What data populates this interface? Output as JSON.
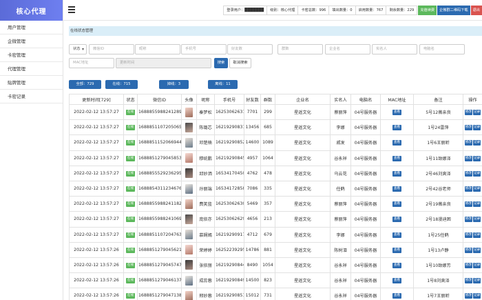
{
  "app": {
    "logo": "核心代理"
  },
  "sidebar": {
    "items": [
      {
        "label": "用户管理"
      },
      {
        "label": "企微管理"
      },
      {
        "label": "卡密管理"
      },
      {
        "label": "代理管理"
      },
      {
        "label": "贴牌管理"
      },
      {
        "label": "卡密记录"
      }
    ]
  },
  "header": {
    "stats": [
      {
        "label": "登录用户：",
        "value": "███████"
      },
      {
        "label": "级别：",
        "value": "核心代理"
      },
      {
        "label": "卡密总数：",
        "value": "996"
      },
      {
        "label": "填出数量：",
        "value": "0"
      },
      {
        "label": "启用数量：",
        "value": "767"
      },
      {
        "label": "剩余数量：",
        "value": "229"
      }
    ],
    "buttons": [
      {
        "label": "充值续费",
        "color": "#5cb85c"
      },
      {
        "label": "企微群二维码下载",
        "color": "#2b6ab0"
      },
      {
        "label": "退出",
        "color": "#d9534f"
      }
    ]
  },
  "panel": {
    "title": "在线状态管理"
  },
  "filters": {
    "status_select": "状态",
    "placeholders": [
      "微信ID",
      "昵称",
      "手机号",
      "好友数",
      "群数",
      "企业名",
      "实名人",
      "电脑名",
      "MAC地址",
      "更新时间"
    ],
    "search_button": "搜索",
    "cancel_button": "取消搜索"
  },
  "tabs": [
    {
      "label": "全部：729"
    },
    {
      "label": "在线：715"
    },
    {
      "label": "掉线：3"
    },
    {
      "label": "离线：11"
    }
  ],
  "table": {
    "columns": [
      "更新时间[729]",
      "状态",
      "微信ID",
      "头像",
      "昵称",
      "手机号",
      "好友数",
      "群数",
      "企业名",
      "实名人",
      "电脑名",
      "MAC地址",
      "备注",
      "操作"
    ],
    "status_label": "在线",
    "view_label": "查看",
    "op_labels": [
      "修改",
      "记录"
    ],
    "rows": [
      {
        "time": "2022-02-12 13:57:27",
        "wxid": "1688855988241289",
        "nick": "秦梦松",
        "phone": "16253062631",
        "friends": "7701",
        "groups": "299",
        "company": "星遥文化",
        "realname": "蔡丽萍",
        "pc": "04号服务器",
        "note": "5号12薇亲良"
      },
      {
        "time": "2022-02-12 13:57:27",
        "wxid": "1688851107205065",
        "nick": "陈璐芯",
        "phone": "16219290831",
        "friends": "13456",
        "groups": "685",
        "company": "星遥文化",
        "realname": "李娜",
        "pc": "04号服务器",
        "note": "1号24雷萍"
      },
      {
        "time": "2022-02-12 13:57:27",
        "wxid": "1688851152066944",
        "nick": "邓楚楠",
        "phone": "16219290852",
        "friends": "14600",
        "groups": "1089",
        "company": "星遥文化",
        "realname": "戚发",
        "pc": "04号服务器",
        "note": "1号6王丽昕"
      },
      {
        "time": "2022-02-12 13:57:27",
        "wxid": "1688851279045853",
        "nick": "穆统鹏",
        "phone": "16219290845",
        "friends": "4957",
        "groups": "1064",
        "company": "星遥文化",
        "realname": "谷永祥",
        "pc": "04号服务器",
        "note": "1号11致娜泽"
      },
      {
        "time": "2022-02-12 13:57:27",
        "wxid": "1688855529236295",
        "nick": "邱妙洒",
        "phone": "16534170450",
        "friends": "4762",
        "groups": "478",
        "company": "星遥文化",
        "realname": "乌云花",
        "pc": "04号服务器",
        "note": "2号46刘爽泽"
      },
      {
        "time": "2022-02-12 13:57:27",
        "wxid": "1688854311234676",
        "nick": "孙丽端",
        "phone": "16534172858",
        "friends": "7086",
        "groups": "335",
        "company": "星遥文化",
        "realname": "任鹤",
        "pc": "04号服务器",
        "note": "2号42谷老师"
      },
      {
        "time": "2022-02-12 13:57:27",
        "wxid": "1688855988241182",
        "nick": "费笑蓝",
        "phone": "16253062630",
        "friends": "5469",
        "groups": "357",
        "company": "星遥文化",
        "realname": "蔡丽萍",
        "pc": "04号服务器",
        "note": "2号19薇亲良"
      },
      {
        "time": "2022-02-12 13:57:27",
        "wxid": "1688855988241069",
        "nick": "庞依亦",
        "phone": "16253062629",
        "friends": "4656",
        "groups": "213",
        "company": "星遥文化",
        "realname": "蔡丽萍",
        "pc": "04号服务器",
        "note": "2号18漫迪困"
      },
      {
        "time": "2022-02-12 13:57:27",
        "wxid": "1688851107204763",
        "nick": "慕娴嫣",
        "phone": "16219290917",
        "friends": "4712",
        "groups": "679",
        "company": "星遥文化",
        "realname": "李娜",
        "pc": "04号服务器",
        "note": "1号25任鹤"
      },
      {
        "time": "2022-02-12 13:57:26",
        "wxid": "1688851279045621",
        "nick": "荣婷婷",
        "phone": "16252239295",
        "friends": "14786",
        "groups": "881",
        "company": "星遥文化",
        "realname": "陈树泪",
        "pc": "04号服务器",
        "note": "1号13卢静"
      },
      {
        "time": "2022-02-12 13:57:26",
        "wxid": "1688851279045747",
        "nick": "张依丽",
        "phone": "16219290844",
        "friends": "8490",
        "groups": "1054",
        "company": "星遥文化",
        "realname": "谷永祥",
        "pc": "04号服务器",
        "note": "1号10致娜芳"
      },
      {
        "time": "2022-02-12 13:57:26",
        "wxid": "1688851279046137",
        "nick": "成蕊蓉",
        "phone": "16219290849",
        "friends": "14500",
        "groups": "823",
        "company": "星遥文化",
        "realname": "谷永祥",
        "pc": "04号服务器",
        "note": "1号8刘爽泽"
      },
      {
        "time": "2022-02-12 13:57:26",
        "wxid": "1688851279047138",
        "nick": "邢妙蓉",
        "phone": "16219290851",
        "friends": "15012",
        "groups": "731",
        "company": "星遥文化",
        "realname": "谷永祥",
        "pc": "04号服务器",
        "note": "1号7王丽昕"
      }
    ]
  }
}
